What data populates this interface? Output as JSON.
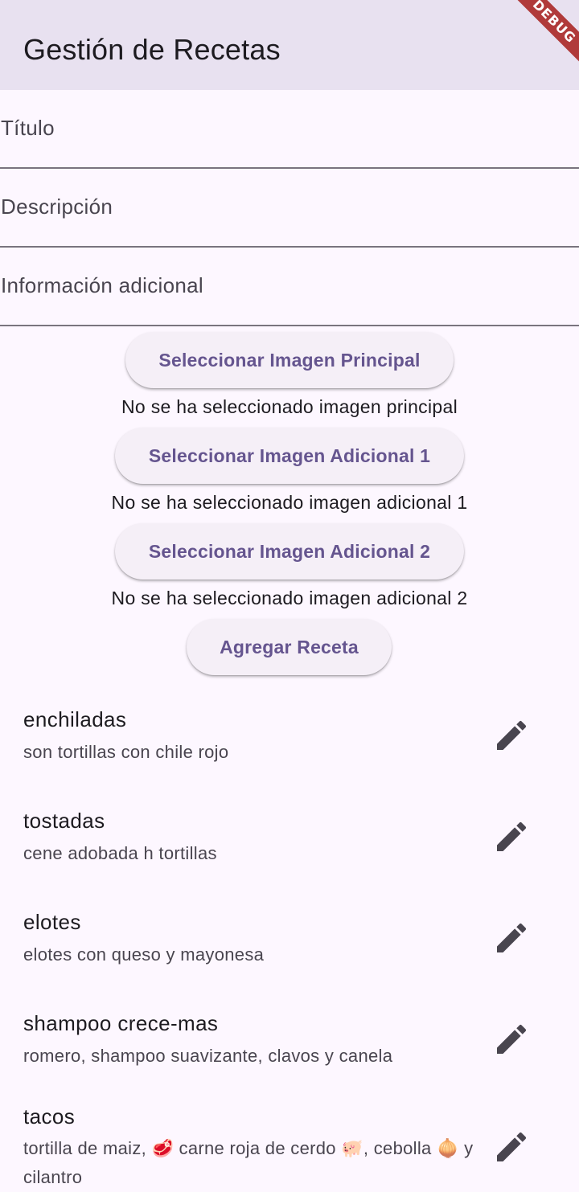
{
  "app_bar": {
    "title": "Gestión de Recetas",
    "debug_banner": "DEBUG"
  },
  "form": {
    "fields": [
      {
        "label": "Título",
        "value": ""
      },
      {
        "label": "Descripción",
        "value": ""
      },
      {
        "label": "Información adicional",
        "value": ""
      }
    ],
    "buttons": {
      "main_image": "Seleccionar Imagen Principal",
      "additional_image_1": "Seleccionar Imagen Adicional 1",
      "additional_image_2": "Seleccionar Imagen Adicional 2",
      "add_recipe": "Agregar Receta"
    },
    "status": {
      "main_image": "No se ha seleccionado imagen principal",
      "additional_image_1": "No se ha seleccionado imagen adicional 1",
      "additional_image_2": "No se ha seleccionado imagen adicional 2"
    }
  },
  "recipes": [
    {
      "title": "enchiladas",
      "description": "son tortillas con chile rojo",
      "edit_icon": "edit-icon"
    },
    {
      "title": "tostadas",
      "description": "cene adobada h tortillas",
      "edit_icon": "edit-icon"
    },
    {
      "title": "elotes",
      "description": "elotes con queso y mayonesa",
      "edit_icon": "edit-icon"
    },
    {
      "title": "shampoo crece-mas",
      "description": "romero, shampoo suavizante, clavos y canela",
      "edit_icon": "edit-icon"
    },
    {
      "title": "tacos",
      "description": "tortilla de maiz, 🥩 carne roja de cerdo 🐖, cebolla 🧅 y cilantro",
      "edit_icon": "edit-icon"
    }
  ],
  "colors": {
    "app_bar_bg": "#e8e1f0",
    "background": "#fdf7ff",
    "button_bg": "#f5eff7",
    "button_text": "#65558f",
    "divider": "#79747e",
    "debug_banner": "#b03a3a"
  }
}
